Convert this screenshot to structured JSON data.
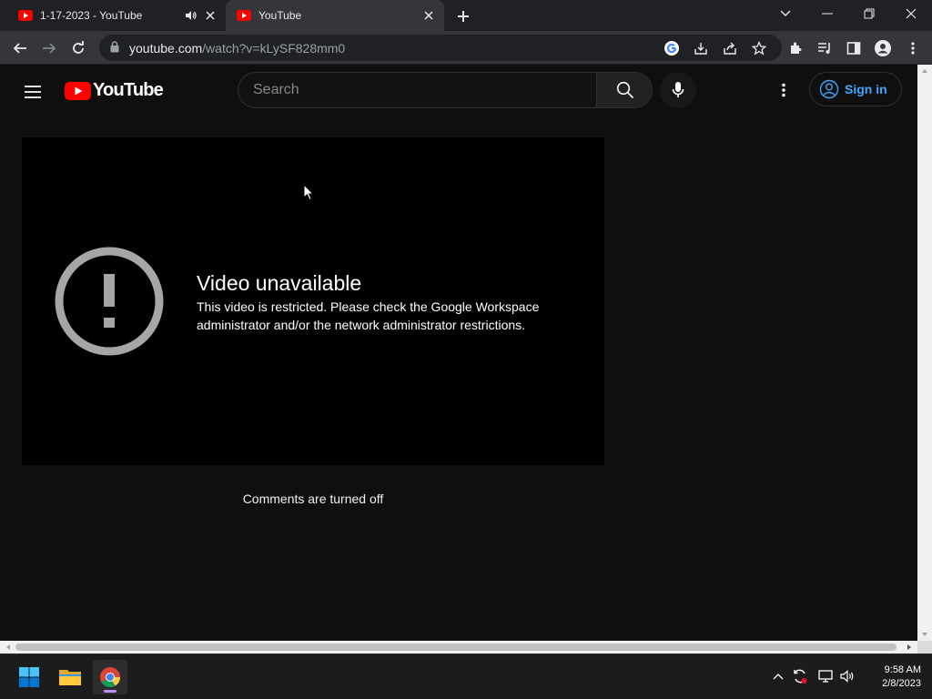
{
  "browser": {
    "tabs": [
      {
        "title": "1-17-2023 - YouTube",
        "active": false,
        "audio": true
      },
      {
        "title": "YouTube",
        "active": true,
        "audio": false
      }
    ],
    "url_host": "youtube.com",
    "url_path": "/watch?v=kLySF828mm0"
  },
  "youtube": {
    "logo_text": "YouTube",
    "search_placeholder": "Search",
    "signin_label": "Sign in",
    "brand_color": "#ff0000",
    "link_color": "#3ea6ff"
  },
  "player": {
    "error_title": "Video unavailable",
    "error_message": "This video is restricted. Please check the Google Workspace administrator and/or the network administrator restrictions."
  },
  "comments": {
    "status": "Comments are turned off"
  },
  "taskbar": {
    "apps": [
      "start-icon",
      "file-explorer-icon",
      "chrome-icon"
    ],
    "clock_time": "9:58 AM",
    "clock_date": "2/8/2023"
  }
}
